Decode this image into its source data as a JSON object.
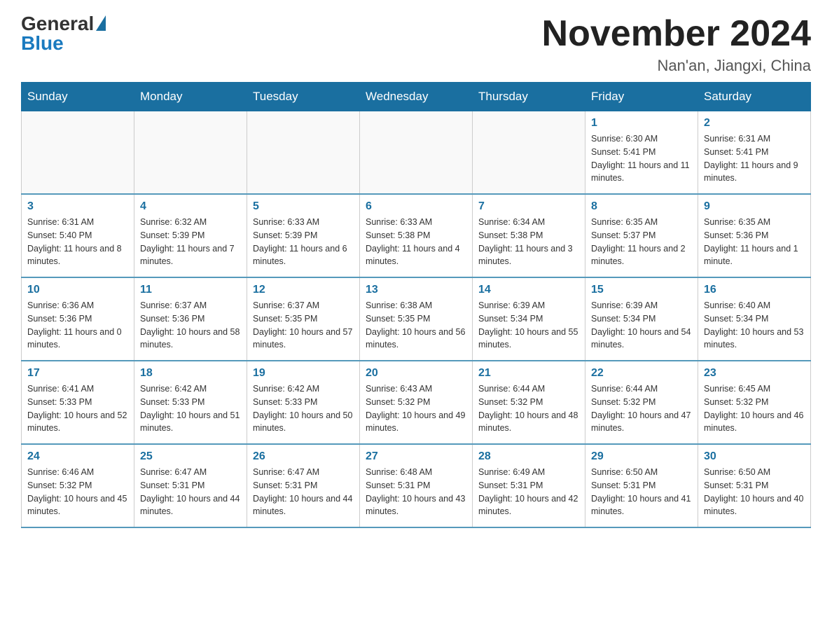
{
  "header": {
    "logo_general": "General",
    "logo_blue": "Blue",
    "month_title": "November 2024",
    "location": "Nan'an, Jiangxi, China"
  },
  "weekdays": [
    "Sunday",
    "Monday",
    "Tuesday",
    "Wednesday",
    "Thursday",
    "Friday",
    "Saturday"
  ],
  "weeks": [
    [
      {
        "day": "",
        "info": ""
      },
      {
        "day": "",
        "info": ""
      },
      {
        "day": "",
        "info": ""
      },
      {
        "day": "",
        "info": ""
      },
      {
        "day": "",
        "info": ""
      },
      {
        "day": "1",
        "info": "Sunrise: 6:30 AM\nSunset: 5:41 PM\nDaylight: 11 hours and 11 minutes."
      },
      {
        "day": "2",
        "info": "Sunrise: 6:31 AM\nSunset: 5:41 PM\nDaylight: 11 hours and 9 minutes."
      }
    ],
    [
      {
        "day": "3",
        "info": "Sunrise: 6:31 AM\nSunset: 5:40 PM\nDaylight: 11 hours and 8 minutes."
      },
      {
        "day": "4",
        "info": "Sunrise: 6:32 AM\nSunset: 5:39 PM\nDaylight: 11 hours and 7 minutes."
      },
      {
        "day": "5",
        "info": "Sunrise: 6:33 AM\nSunset: 5:39 PM\nDaylight: 11 hours and 6 minutes."
      },
      {
        "day": "6",
        "info": "Sunrise: 6:33 AM\nSunset: 5:38 PM\nDaylight: 11 hours and 4 minutes."
      },
      {
        "day": "7",
        "info": "Sunrise: 6:34 AM\nSunset: 5:38 PM\nDaylight: 11 hours and 3 minutes."
      },
      {
        "day": "8",
        "info": "Sunrise: 6:35 AM\nSunset: 5:37 PM\nDaylight: 11 hours and 2 minutes."
      },
      {
        "day": "9",
        "info": "Sunrise: 6:35 AM\nSunset: 5:36 PM\nDaylight: 11 hours and 1 minute."
      }
    ],
    [
      {
        "day": "10",
        "info": "Sunrise: 6:36 AM\nSunset: 5:36 PM\nDaylight: 11 hours and 0 minutes."
      },
      {
        "day": "11",
        "info": "Sunrise: 6:37 AM\nSunset: 5:36 PM\nDaylight: 10 hours and 58 minutes."
      },
      {
        "day": "12",
        "info": "Sunrise: 6:37 AM\nSunset: 5:35 PM\nDaylight: 10 hours and 57 minutes."
      },
      {
        "day": "13",
        "info": "Sunrise: 6:38 AM\nSunset: 5:35 PM\nDaylight: 10 hours and 56 minutes."
      },
      {
        "day": "14",
        "info": "Sunrise: 6:39 AM\nSunset: 5:34 PM\nDaylight: 10 hours and 55 minutes."
      },
      {
        "day": "15",
        "info": "Sunrise: 6:39 AM\nSunset: 5:34 PM\nDaylight: 10 hours and 54 minutes."
      },
      {
        "day": "16",
        "info": "Sunrise: 6:40 AM\nSunset: 5:34 PM\nDaylight: 10 hours and 53 minutes."
      }
    ],
    [
      {
        "day": "17",
        "info": "Sunrise: 6:41 AM\nSunset: 5:33 PM\nDaylight: 10 hours and 52 minutes."
      },
      {
        "day": "18",
        "info": "Sunrise: 6:42 AM\nSunset: 5:33 PM\nDaylight: 10 hours and 51 minutes."
      },
      {
        "day": "19",
        "info": "Sunrise: 6:42 AM\nSunset: 5:33 PM\nDaylight: 10 hours and 50 minutes."
      },
      {
        "day": "20",
        "info": "Sunrise: 6:43 AM\nSunset: 5:32 PM\nDaylight: 10 hours and 49 minutes."
      },
      {
        "day": "21",
        "info": "Sunrise: 6:44 AM\nSunset: 5:32 PM\nDaylight: 10 hours and 48 minutes."
      },
      {
        "day": "22",
        "info": "Sunrise: 6:44 AM\nSunset: 5:32 PM\nDaylight: 10 hours and 47 minutes."
      },
      {
        "day": "23",
        "info": "Sunrise: 6:45 AM\nSunset: 5:32 PM\nDaylight: 10 hours and 46 minutes."
      }
    ],
    [
      {
        "day": "24",
        "info": "Sunrise: 6:46 AM\nSunset: 5:32 PM\nDaylight: 10 hours and 45 minutes."
      },
      {
        "day": "25",
        "info": "Sunrise: 6:47 AM\nSunset: 5:31 PM\nDaylight: 10 hours and 44 minutes."
      },
      {
        "day": "26",
        "info": "Sunrise: 6:47 AM\nSunset: 5:31 PM\nDaylight: 10 hours and 44 minutes."
      },
      {
        "day": "27",
        "info": "Sunrise: 6:48 AM\nSunset: 5:31 PM\nDaylight: 10 hours and 43 minutes."
      },
      {
        "day": "28",
        "info": "Sunrise: 6:49 AM\nSunset: 5:31 PM\nDaylight: 10 hours and 42 minutes."
      },
      {
        "day": "29",
        "info": "Sunrise: 6:50 AM\nSunset: 5:31 PM\nDaylight: 10 hours and 41 minutes."
      },
      {
        "day": "30",
        "info": "Sunrise: 6:50 AM\nSunset: 5:31 PM\nDaylight: 10 hours and 40 minutes."
      }
    ]
  ]
}
